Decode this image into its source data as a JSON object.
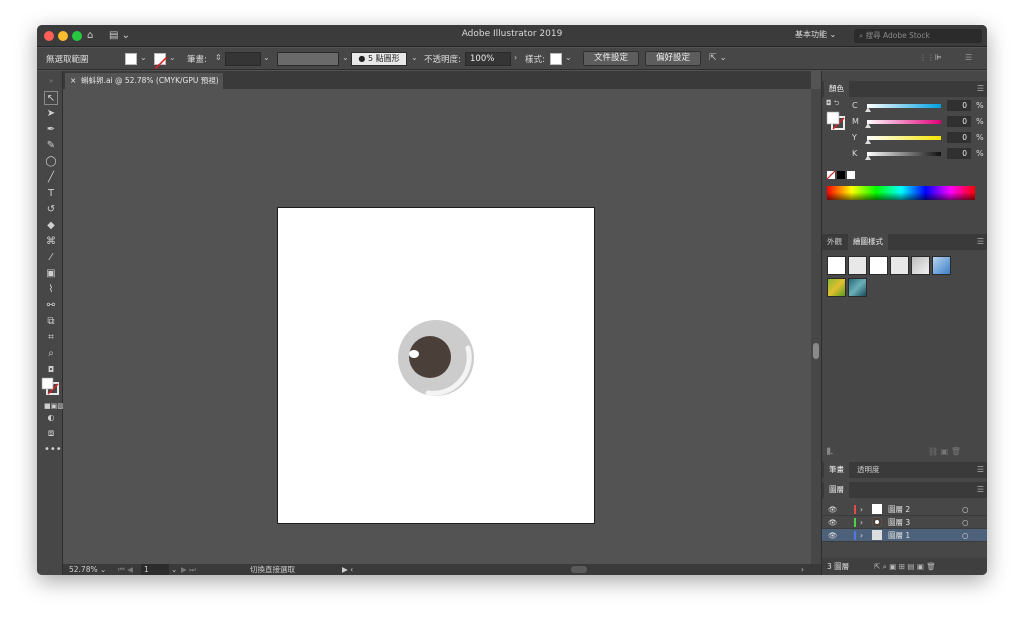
{
  "window": {
    "title": "Adobe Illustrator 2019",
    "workspace": "基本功能",
    "search_placeholder": "搜尋 Adobe Stock"
  },
  "control_bar": {
    "selection_label": "無選取範圍",
    "stroke_label": "筆畫:",
    "brush_label": "5 點圓形",
    "opacity_label": "不透明度:",
    "opacity_value": "100%",
    "style_label": "樣式:",
    "doc_setup_button": "文件設定",
    "preferences_button": "偏好設定"
  },
  "document": {
    "tab_label": "蝌蚪卵.ai @ 52.78% (CMYK/GPU 預視)"
  },
  "status": {
    "zoom": "52.78%",
    "artboard_index": "1",
    "tool_hint": "切換直接選取"
  },
  "color_panel": {
    "tab": "顏色",
    "channels": [
      {
        "label": "C",
        "value": "0",
        "unit": "%"
      },
      {
        "label": "M",
        "value": "0",
        "unit": "%"
      },
      {
        "label": "Y",
        "value": "0",
        "unit": "%"
      },
      {
        "label": "K",
        "value": "0",
        "unit": "%"
      }
    ]
  },
  "graphic_styles_panel": {
    "tabs": [
      "外觀",
      "繪圖樣式"
    ]
  },
  "stroke_panel": {
    "tabs": [
      "筆畫",
      "透明度"
    ]
  },
  "layers_panel": {
    "tab": "圖層",
    "layers": [
      {
        "name": "圖層 2",
        "color": "#e84a4a"
      },
      {
        "name": "圖層 3",
        "color": "#4ad24a"
      },
      {
        "name": "圖層 1",
        "color": "#4a7ae8"
      }
    ],
    "count_label": "3 圖層"
  }
}
